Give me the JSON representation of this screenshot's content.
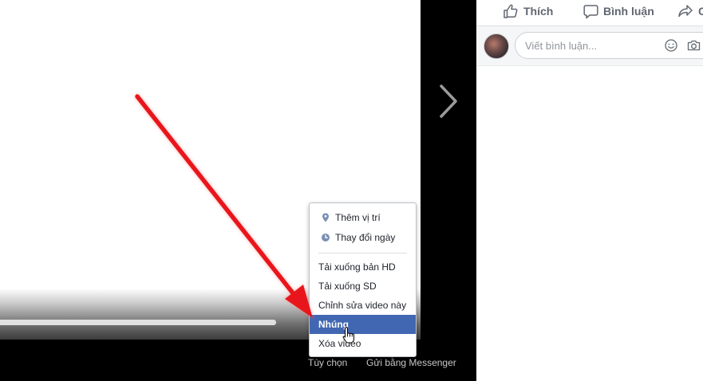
{
  "actions": {
    "like_label": "Thích",
    "comment_label": "Bình luận",
    "share_label": "C"
  },
  "comment_box": {
    "placeholder": "Viết bình luận..."
  },
  "video": {
    "progress_fraction": 1.0
  },
  "menu": {
    "items": [
      {
        "label": "Thêm vị trí",
        "icon": "location-pin-icon"
      },
      {
        "label": "Thay đổi ngày",
        "icon": "clock-icon"
      },
      {
        "label": "Tải xuống bản HD"
      },
      {
        "label": "Tải xuống SD"
      },
      {
        "label": "Chỉnh sửa video này"
      },
      {
        "label": "Nhúng",
        "selected": true
      },
      {
        "label": "Xóa video"
      }
    ]
  },
  "footer": {
    "options_label": "Tùy chọn",
    "messenger_label": "Gửi bằng Messenger"
  },
  "colors": {
    "accent": "#4267b2",
    "arrow": "#e8161a",
    "text_secondary": "#606770"
  }
}
